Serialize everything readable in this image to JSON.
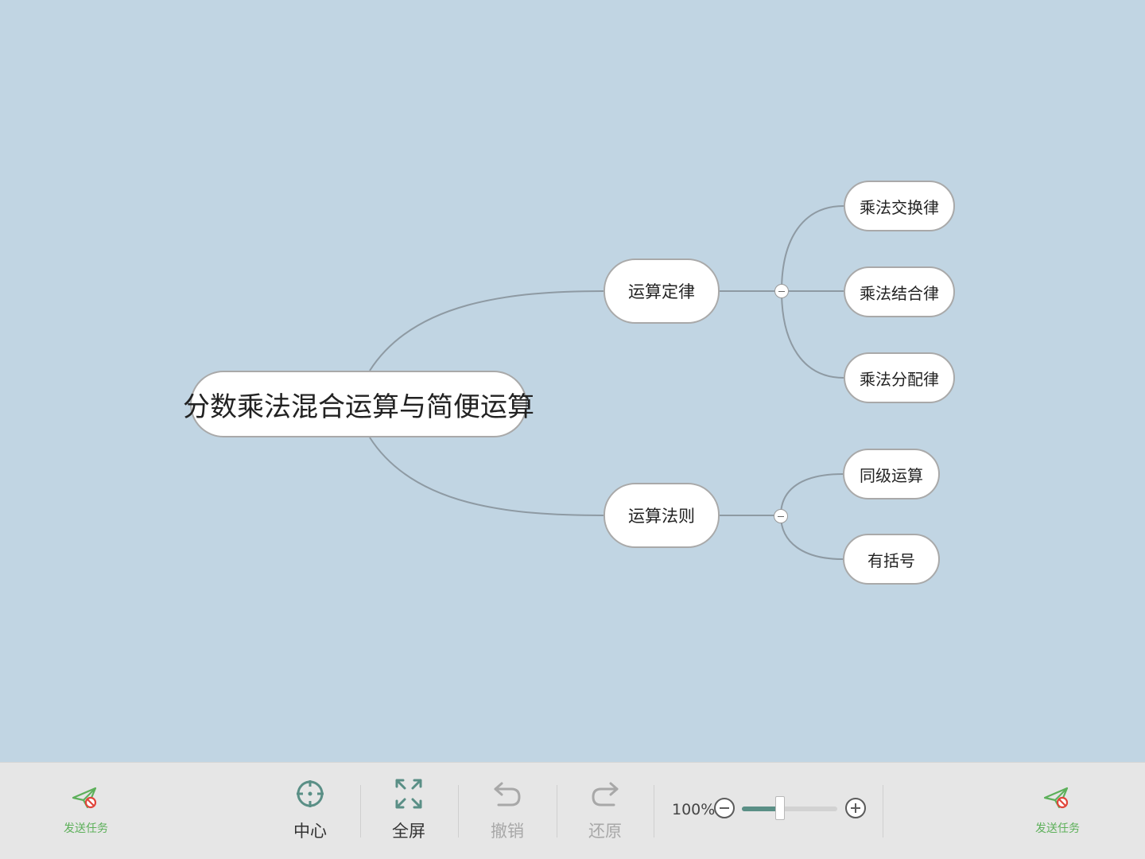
{
  "mindmap": {
    "root": {
      "label": "分数乘法混合运算与简便运算"
    },
    "branches": [
      {
        "label": "运算定律",
        "collapsed": false,
        "children": [
          {
            "label": "乘法交换律"
          },
          {
            "label": "乘法结合律"
          },
          {
            "label": "乘法分配律"
          }
        ]
      },
      {
        "label": "运算法则",
        "collapsed": false,
        "children": [
          {
            "label": "同级运算"
          },
          {
            "label": "有括号"
          }
        ]
      }
    ],
    "colors": {
      "background": "#c1d5e3",
      "node_fill": "#ffffff",
      "node_border": "#a9a9a9",
      "link": "#8e9aa3"
    }
  },
  "toolbar": {
    "send_task_left": {
      "label": "发送任务",
      "icon": "paper-plane-blocked-icon"
    },
    "center": {
      "label": "中心",
      "icon": "crosshair-icon"
    },
    "fullscreen": {
      "label": "全屏",
      "icon": "expand-arrows-icon"
    },
    "undo": {
      "label": "撤销",
      "icon": "undo-arrow-icon",
      "enabled": false
    },
    "redo": {
      "label": "还原",
      "icon": "redo-arrow-icon",
      "enabled": false
    },
    "zoom": {
      "text": "100%",
      "level": 0.4
    },
    "send_task_right": {
      "label": "发送任务",
      "icon": "paper-plane-blocked-icon"
    },
    "colors": {
      "text": "#333333",
      "disabled_text": "#a8a8a8",
      "icon_teal": "#5a8f86",
      "send_green": "#5db05a",
      "blocked_red": "#e0453b"
    }
  }
}
